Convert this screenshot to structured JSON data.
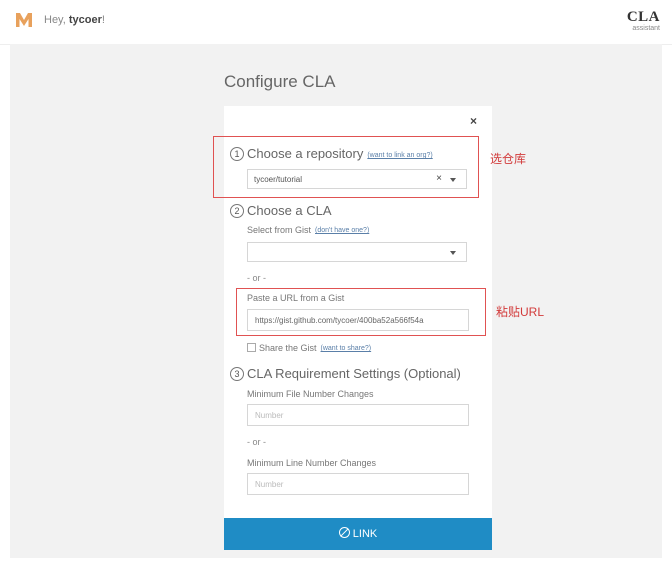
{
  "header": {
    "greeting_prefix": "Hey,",
    "username": "tycoer",
    "greeting_suffix": "!",
    "brand_line1": "CLA",
    "brand_line2": "assistant"
  },
  "page": {
    "title": "Configure CLA"
  },
  "card": {
    "close_glyph": "×",
    "step1": {
      "number": "1",
      "title": "Choose a repository",
      "hint": "(want to link an org?)",
      "selected_value": "tycoer/tutorial",
      "clear_glyph": "×"
    },
    "step2": {
      "number": "2",
      "title": "Choose a CLA",
      "gist_label": "Select from Gist",
      "gist_hint": "(don't have one?)",
      "gist_value": "",
      "or_text": "- or -",
      "url_label": "Paste a URL from a Gist",
      "url_value": "https://gist.github.com/tycoer/400ba52a566f54a",
      "share_label": "Share the Gist",
      "share_hint": "(want to share?)",
      "share_checked": false
    },
    "step3": {
      "number": "3",
      "title": "CLA Requirement Settings (Optional)",
      "file_label": "Minimum File Number Changes",
      "file_placeholder": "Number",
      "or_text": "- or -",
      "line_label": "Minimum Line Number Changes",
      "line_placeholder": "Number"
    },
    "link_button": "LINK"
  },
  "annotations": {
    "repo_note": "选仓库",
    "url_note": "粘贴URL",
    "color": "#e05252"
  },
  "colors": {
    "accent": "#1f8cc5",
    "background": "#f2f2f2",
    "logo": "#e8a15c"
  }
}
